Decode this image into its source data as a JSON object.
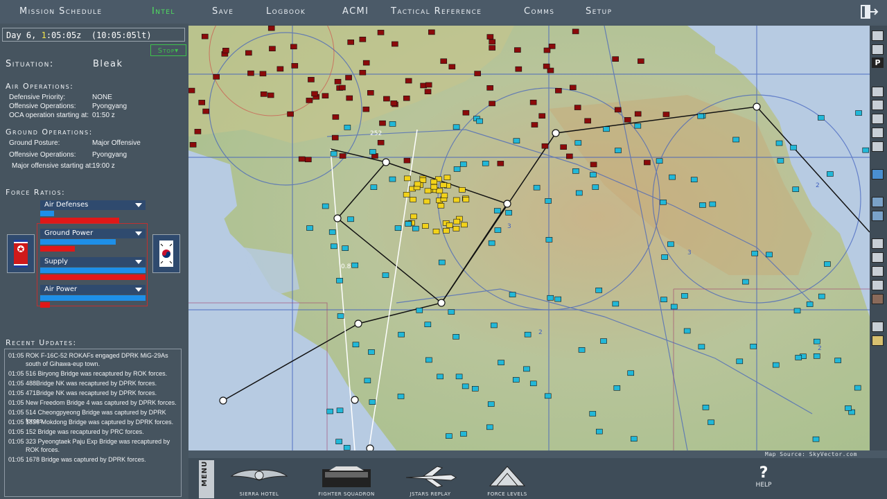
{
  "top_menu": [
    {
      "label": "Mission Schedule",
      "active": false
    },
    {
      "label": "Intel",
      "active": true
    },
    {
      "label": "Save",
      "active": false
    },
    {
      "label": "Logbook",
      "active": false
    },
    {
      "label": "ACMI",
      "active": false
    },
    {
      "label": "Tactical Reference",
      "active": false
    },
    {
      "label": "Comms",
      "active": false
    },
    {
      "label": "Setup",
      "active": false
    }
  ],
  "clock": {
    "day": "Day 6,",
    "hour_digit": "1",
    "time_rest": ":05:05z",
    "local": "(10:05:05lt)"
  },
  "stop_button": "Stop",
  "situation": {
    "label": "Situation:",
    "value": "Bleak"
  },
  "air_ops": {
    "header": "Air Operations:",
    "rows": [
      {
        "label": "Defensive Priority:",
        "value": "NONE"
      },
      {
        "label": "Offensive Operations:",
        "value": "Pyongyang"
      },
      {
        "label": "OCA operation starting at:",
        "value": "01:50 z"
      }
    ]
  },
  "ground_ops": {
    "header": "Ground Operations:",
    "rows": [
      {
        "label": "Ground Posture:",
        "value": "Major Offensive"
      },
      {
        "label": "Offensive Operations:",
        "value": "Pyongyang"
      },
      {
        "label": "Major offensive starting at:",
        "value": "19:00 z"
      }
    ]
  },
  "force_ratios": {
    "header": "Force Ratios:",
    "items": [
      {
        "label": "Air Defenses",
        "blue": 0.13,
        "red": 0.75
      },
      {
        "label": "Ground Power",
        "blue": 0.72,
        "red": 0.33
      },
      {
        "label": "Supply",
        "blue": 1.0,
        "red": 1.0
      },
      {
        "label": "Air Power",
        "blue": 1.0,
        "red": 0.09
      }
    ]
  },
  "recent_updates": {
    "header": "Recent Updates:",
    "items": [
      {
        "time": "01:05",
        "text": "ROK F-16C-52 ROKAFs engaged DPRK MiG-29As south of Gihawa-eup town."
      },
      {
        "time": "01:05",
        "text": "516 Biryong Bridge was recaptured by ROK forces."
      },
      {
        "time": "01:05",
        "text": "488Bridge NK was recaptured by DPRK forces."
      },
      {
        "time": "01:05",
        "text": "471Bridge NK was recaptured by DPRK forces."
      },
      {
        "time": "01:05",
        "text": "New Freedom Bridge 4 was captured by DPRK forces."
      },
      {
        "time": "01:05",
        "text": "514 Cheongpyeong Bridge was captured by DPRK forces."
      },
      {
        "time": "01:05",
        "text": "1836 Mokdong Bridge was captured by DPRK forces."
      },
      {
        "time": "01:05",
        "text": "152 Bridge was recaptured by PRC forces."
      },
      {
        "time": "01:05",
        "text": "323 Pyeongtaek Paju Exp Bridge was recaptured by ROK forces."
      },
      {
        "time": "01:05",
        "text": "1678 Bridge was captured by DPRK forces."
      }
    ]
  },
  "map": {
    "source": "Map Source: SkyVector.com",
    "labels": [
      "252",
      "0.8",
      "3",
      "3",
      "2",
      "2",
      "2"
    ]
  },
  "bottom_menu": {
    "menu_tab": "MENU",
    "items": [
      "SIERRA HOTEL",
      "FIGHTER SQUADRON",
      "JSTARS REPLAY",
      "FORCE LEVELS"
    ],
    "help": {
      "glyph": "?",
      "label": "HELP"
    }
  },
  "right_tools": {
    "p_label": "P"
  }
}
